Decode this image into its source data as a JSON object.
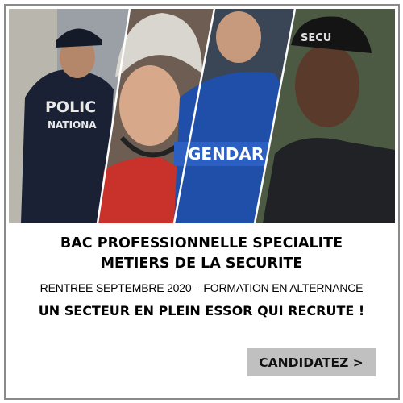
{
  "banner": {
    "photo_labels": {
      "police": "POLIC",
      "police_sub": "NATIONA",
      "gendarmerie": "GENDAR",
      "security": "SECU"
    },
    "title_line1": "BAC PROFESSIONNELLE SPECIALITE",
    "title_line2": "METIERS DE LA SECURITE",
    "subtitle": "RENTREE SEPTEMBRE 2020 – FORMATION EN ALTERNANCE",
    "tagline": "UN SECTEUR EN PLEIN ESSOR QUI RECRUTE !",
    "cta_label": "CANDIDATEZ >",
    "colors": {
      "border": "#8a8a8a",
      "button_bg": "#c0c0c0"
    }
  }
}
